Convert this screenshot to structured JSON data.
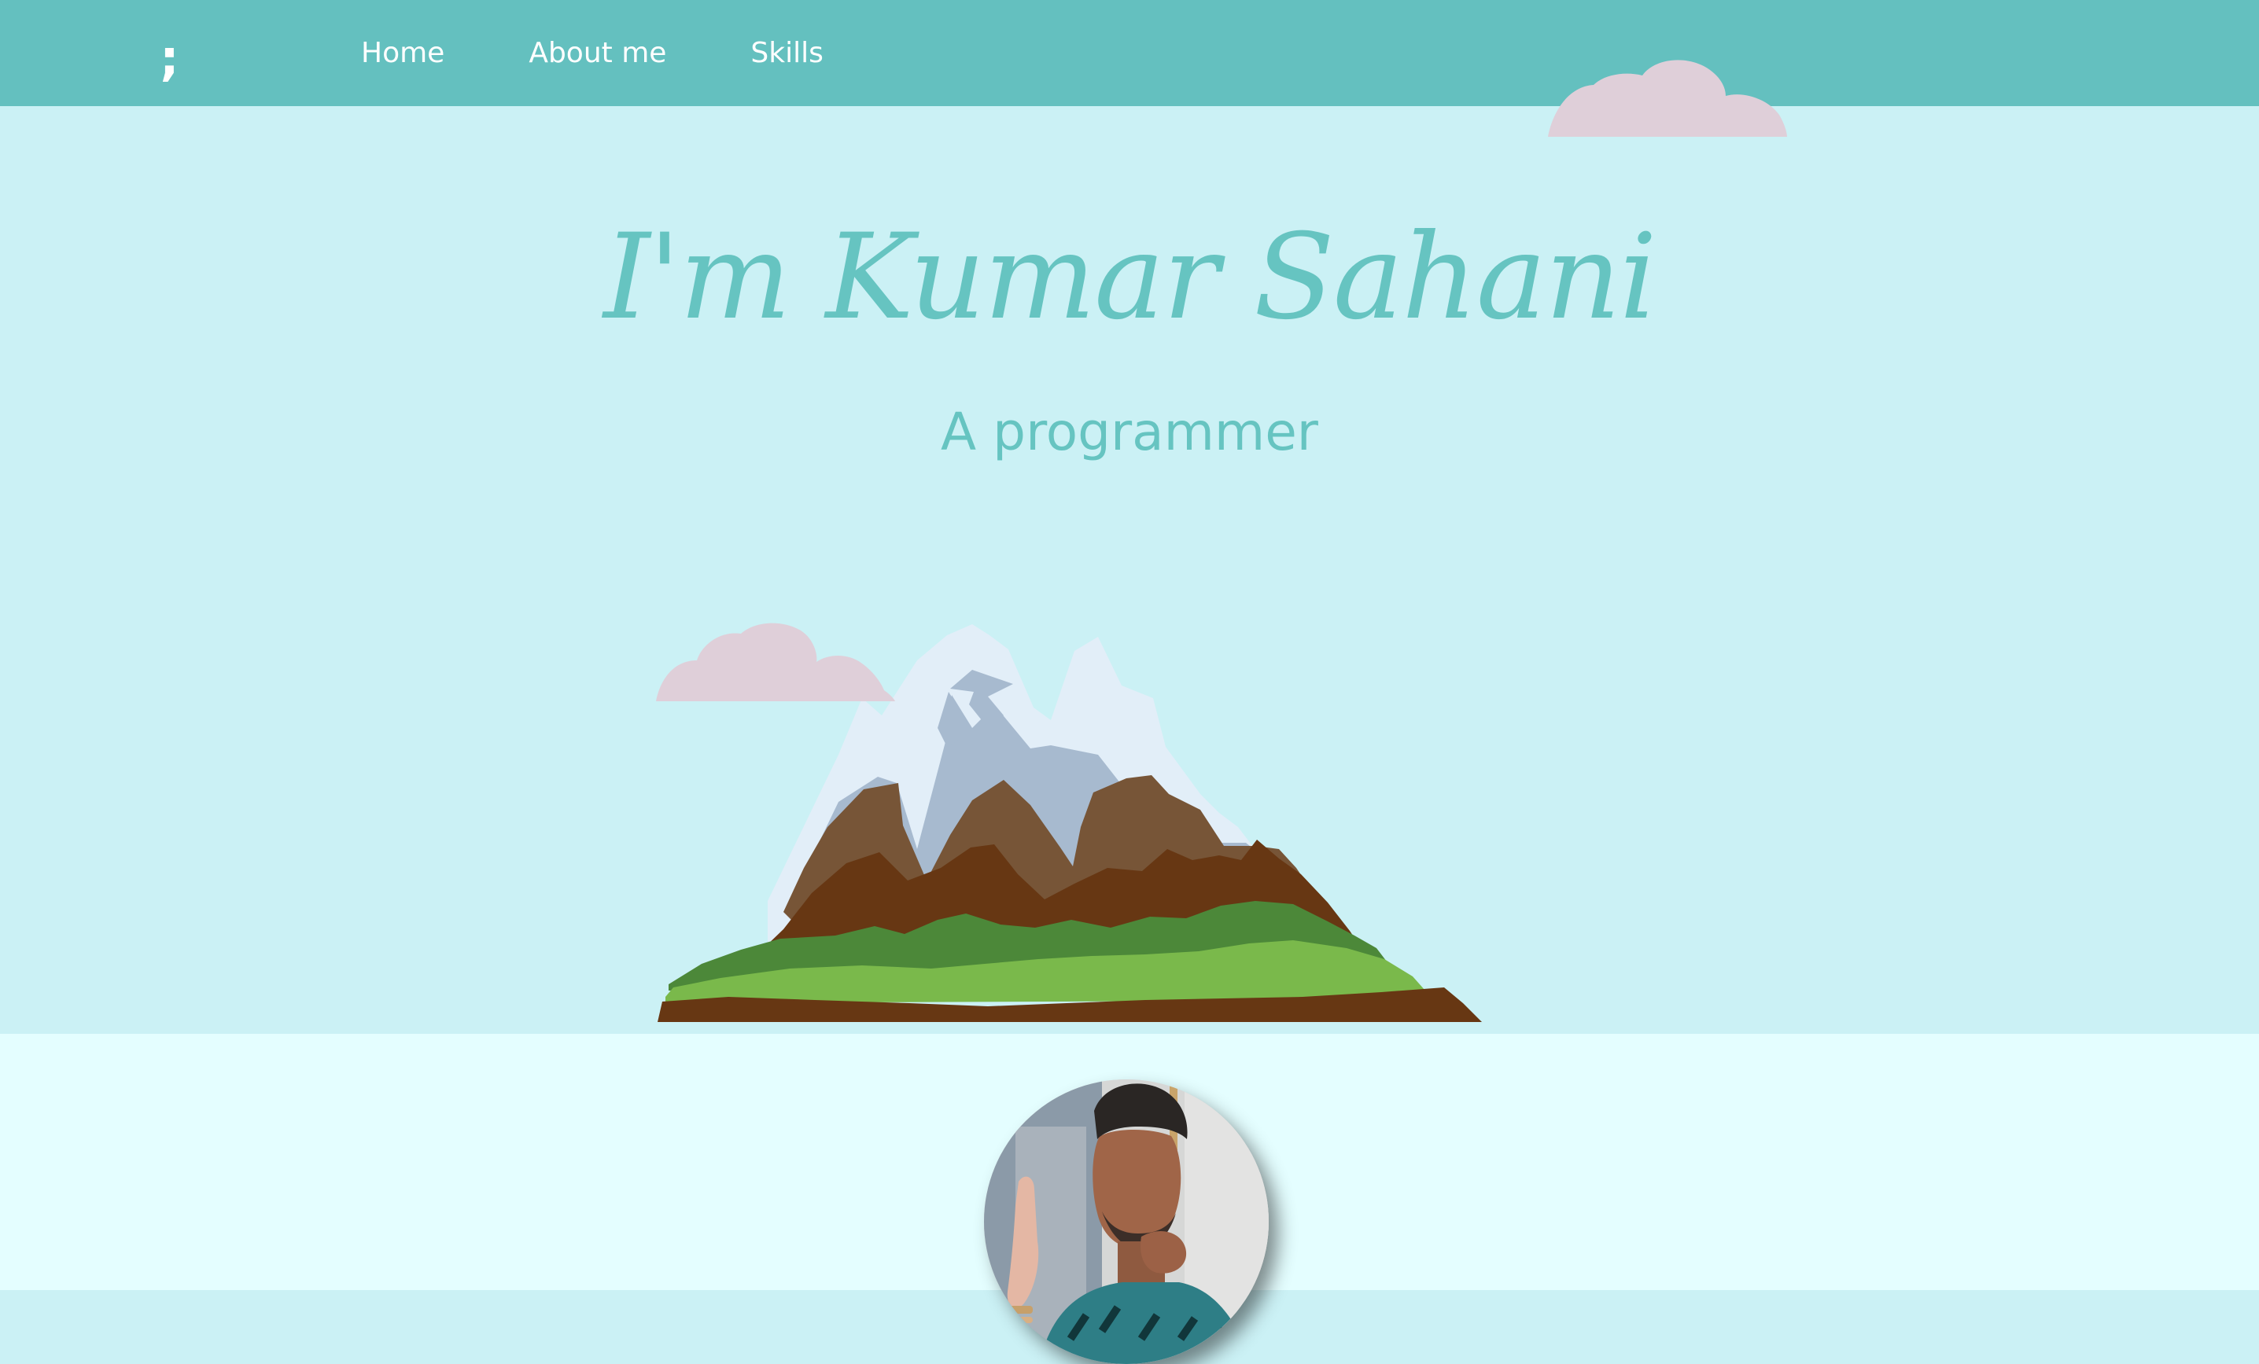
{
  "navbar": {
    "logo": ";",
    "links": [
      "Home",
      "About me",
      "Skills"
    ],
    "background_color": "#64c0bf",
    "text_color": "#ffffff"
  },
  "hero": {
    "title": "I'm Kumar Sahani",
    "subtitle": "A programmer",
    "accent_color": "#66c4c1"
  },
  "illustration": {
    "icon": "mountain-icon",
    "clouds": [
      "cloud-icon",
      "cloud-icon"
    ]
  },
  "profile": {
    "icon": "avatar"
  },
  "colors": {
    "top_background": "#cbf1f5",
    "bottom_background": "#e4feff",
    "cloud": "#dfcfd9"
  }
}
